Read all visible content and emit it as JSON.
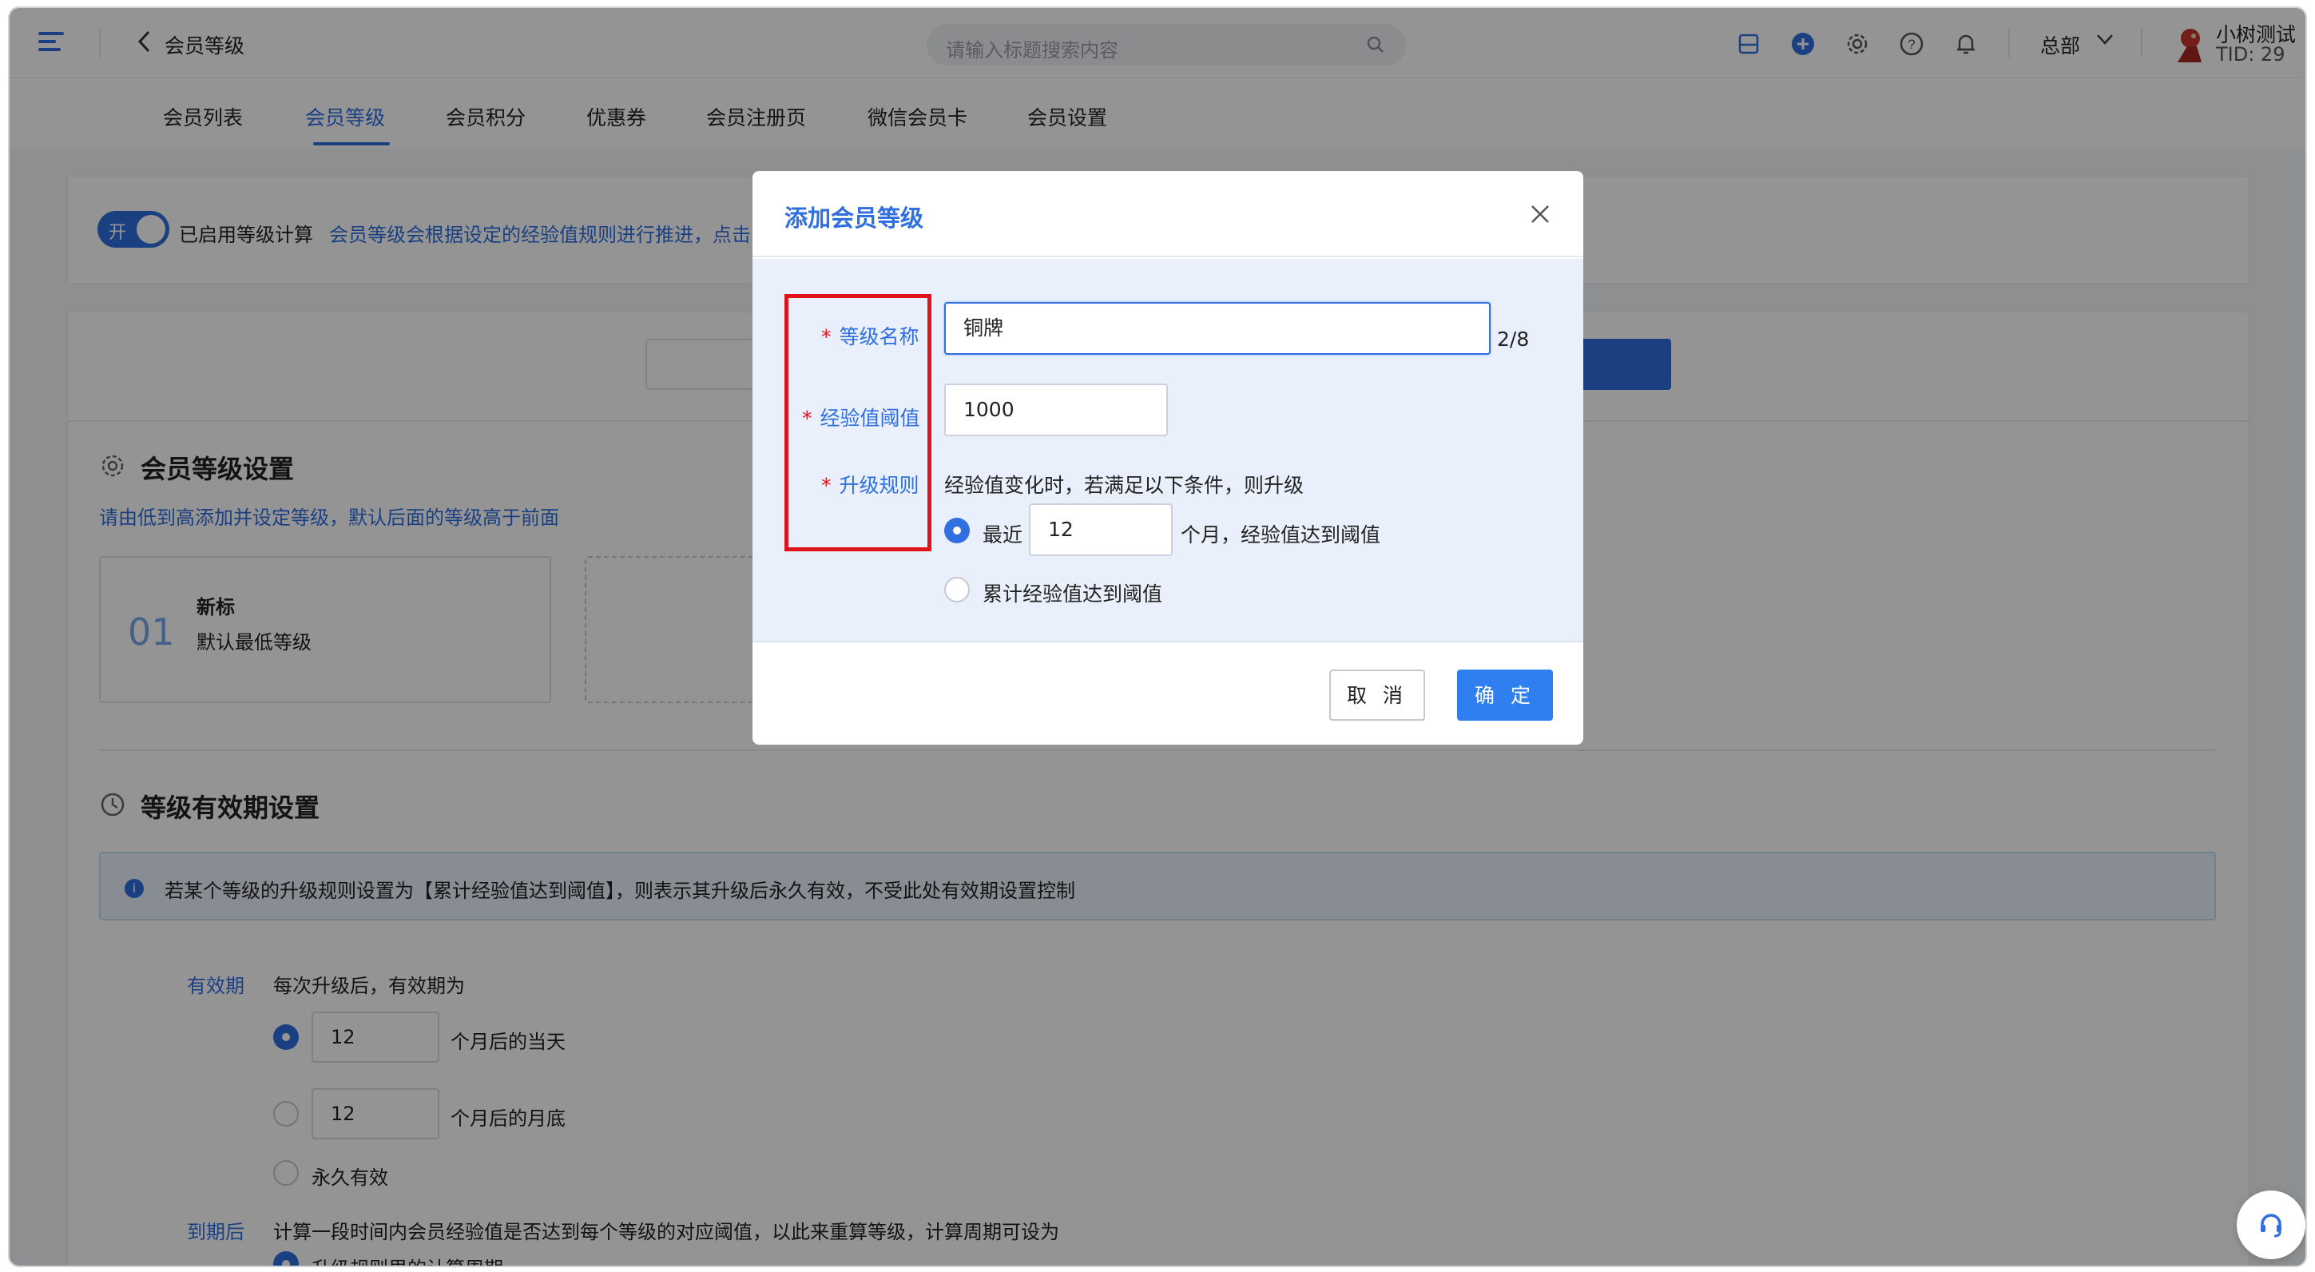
{
  "header": {
    "back_icon": "chevron-left-icon",
    "page_title": "会员等级",
    "search_placeholder": "请输入标题搜索内容",
    "org_name": "总部",
    "user_name": "小树测试",
    "user_tid": "TID: 29"
  },
  "tabs": [
    {
      "label": "会员列表",
      "active": false
    },
    {
      "label": "会员等级",
      "active": true
    },
    {
      "label": "会员积分",
      "active": false
    },
    {
      "label": "优惠券",
      "active": false
    },
    {
      "label": "会员注册页",
      "active": false
    },
    {
      "label": "微信会员卡",
      "active": false
    },
    {
      "label": "会员设置",
      "active": false
    }
  ],
  "level_calc": {
    "toggle_label": "开",
    "enabled_label": "已启用等级计算",
    "description": "会员等级会根据设定的经验值规则进行推进，点击"
  },
  "level_settings": {
    "title": "会员等级设置",
    "description": "请由低到高添加并设定等级，默认后面的等级高于前面",
    "levels": [
      {
        "number": "01",
        "name": "新标",
        "subtitle": "默认最低等级"
      }
    ]
  },
  "validity_settings": {
    "title": "等级有效期设置",
    "notice": "若某个等级的升级规则设置为【累计经验值达到阈值】，则表示其升级后永久有效，不受此处有效期设置控制",
    "validity_label": "有效期",
    "validity_text": "每次升级后，有效期为",
    "options": [
      {
        "value": "12",
        "suffix": "个月后的当天",
        "selected": true
      },
      {
        "value": "12",
        "suffix": "个月后的月底",
        "selected": false
      },
      {
        "label": "永久有效",
        "selected": false
      }
    ],
    "expire_label": "到期后",
    "expire_text": "计算一段时间内会员经验值是否达到每个等级的对应阈值，以此来重算等级，计算周期可设为",
    "expire_option": "升级规则里的计算周期"
  },
  "modal": {
    "title": "添加会员等级",
    "fields": {
      "name_label": "等级名称",
      "name_value": "铜牌",
      "name_counter": "2/8",
      "threshold_label": "经验值阈值",
      "threshold_value": "1000",
      "rule_label": "升级规则",
      "rule_desc": "经验值变化时，若满足以下条件，则升级",
      "rule_recent_prefix": "最近",
      "rule_recent_months": "12",
      "rule_recent_suffix": "个月，经验值达到阈值",
      "rule_cumulative": "累计经验值达到阈值"
    },
    "cancel_label": "取 消",
    "ok_label": "确 定"
  },
  "colors": {
    "accent": "#2f6fe0",
    "highlight_box": "#e0121a",
    "modal_body": "#e9f0fb"
  }
}
